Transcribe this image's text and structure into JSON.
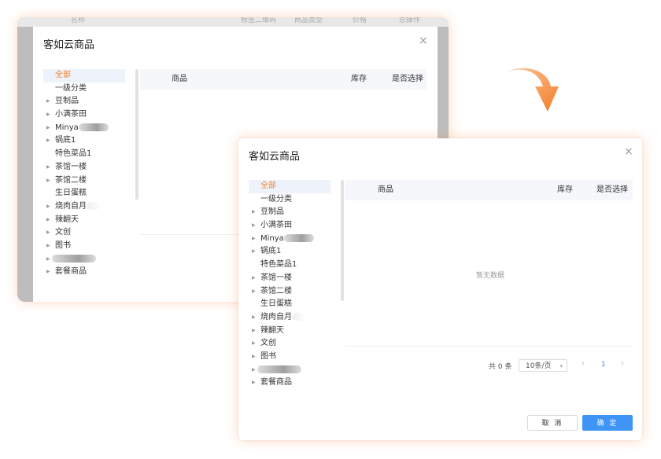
{
  "dialog": {
    "title": "客如云商品",
    "close_icon": "×",
    "tree": [
      {
        "label": "全部",
        "active": true,
        "expandable": false
      },
      {
        "label": "一级分类",
        "expandable": false
      },
      {
        "label": "豆制品",
        "expandable": true
      },
      {
        "label": "小满茶田",
        "expandable": true
      },
      {
        "label": "Minya",
        "expandable": true,
        "redacted": true
      },
      {
        "label": "锅底1",
        "expandable": true
      },
      {
        "label": "特色菜品1",
        "expandable": false
      },
      {
        "label": "茶馆一楼",
        "expandable": true
      },
      {
        "label": "茶馆二楼",
        "expandable": true
      },
      {
        "label": "生日蛋糕",
        "expandable": false
      },
      {
        "label": "烧肉自月",
        "expandable": true,
        "redacted_soft": true
      },
      {
        "label": "辣翻天",
        "expandable": true
      },
      {
        "label": "文创",
        "expandable": true
      },
      {
        "label": "图书",
        "expandable": true
      },
      {
        "label": "",
        "expandable": true,
        "redacted_only": true
      },
      {
        "label": "套餐商品",
        "expandable": true
      }
    ],
    "table": {
      "columns": [
        "商品",
        "库存",
        "是否选择"
      ],
      "empty_text": "暂无数据"
    },
    "pagination": {
      "total_text": "共 0 条",
      "page_size": "10条/页",
      "current_page": "1",
      "prev_icon": "‹",
      "next_icon": "›"
    },
    "buttons": {
      "cancel": "取 消",
      "ok": "确 定"
    }
  },
  "background_header": {
    "labels": [
      "名称",
      "标签二维码",
      "商品类型",
      "价格",
      "总操作"
    ]
  },
  "colors": {
    "accent": "#f0832e",
    "primary": "#3f95f6",
    "arrow": "#f58a3c"
  }
}
